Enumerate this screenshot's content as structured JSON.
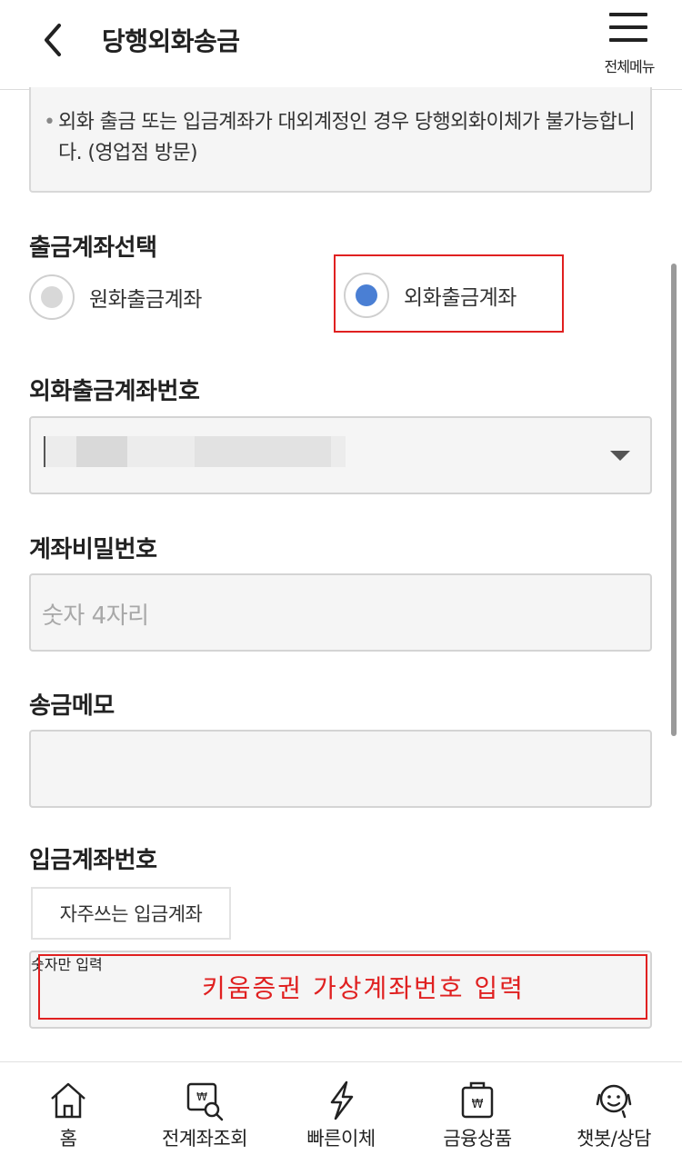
{
  "header": {
    "title": "당행외화송금",
    "menu_label": "전체메뉴"
  },
  "notice": {
    "text": "외화 출금 또는 입금계좌가 대외계정인 경우 당행외화이체가 불가능합니다. (영업점 방문)"
  },
  "withdraw_type": {
    "label": "출금계좌선택",
    "options": [
      {
        "label": "원화출금계좌",
        "selected": false
      },
      {
        "label": "외화출금계좌",
        "selected": true
      }
    ]
  },
  "fx_account": {
    "label": "외화출금계좌번호"
  },
  "password": {
    "label": "계좌비밀번호",
    "placeholder": "숫자 4자리"
  },
  "memo": {
    "label": "송금메모",
    "placeholder": ""
  },
  "deposit": {
    "label": "입금계좌번호",
    "favorites_button": "자주쓰는 입금계좌",
    "placeholder": "숫자만 입력",
    "annotation": "키움증권 가상계좌번호 입력"
  },
  "bottom_nav": [
    {
      "label": "홈",
      "icon": "home-icon"
    },
    {
      "label": "전계좌조회",
      "icon": "account-search-icon"
    },
    {
      "label": "빠른이체",
      "icon": "lightning-icon"
    },
    {
      "label": "금융상품",
      "icon": "product-bag-icon"
    },
    {
      "label": "챗봇/상담",
      "icon": "chatbot-icon"
    }
  ],
  "colors": {
    "accent_blue": "#4a7fd4",
    "highlight_red": "#e02020"
  }
}
